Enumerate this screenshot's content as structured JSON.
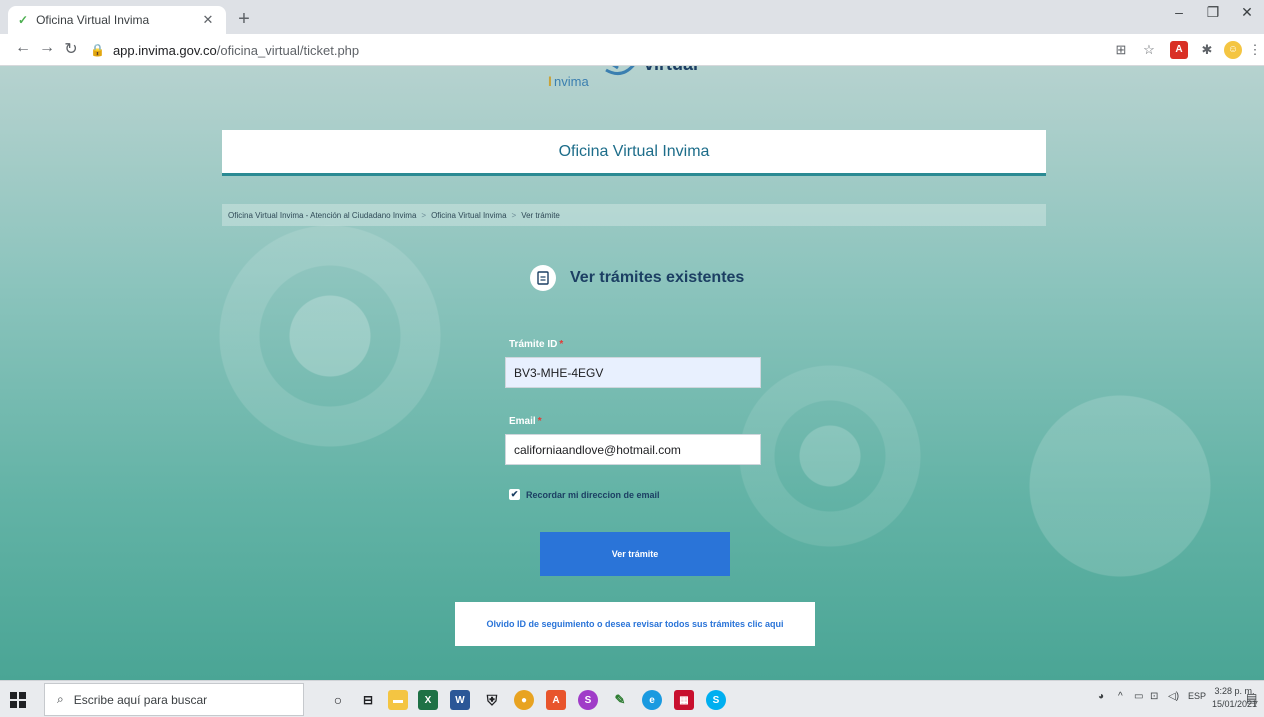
{
  "browser": {
    "tab_title": "Oficina Virtual Invima",
    "tab_favicon": "✓",
    "url_host": "app.invima.gov.co",
    "url_path": "/oficina_virtual/ticket.php"
  },
  "header": {
    "logo_text": "Invima",
    "logo_word": "virtual",
    "title": "Oficina Virtual Invima"
  },
  "breadcrumb": {
    "items": [
      "Oficina Virtual Invima - Atención al Ciudadano Invima",
      "Oficina Virtual Invima",
      "Ver trámite"
    ],
    "separator": ">"
  },
  "form": {
    "heading": "Ver trámites existentes",
    "tramite_label": "Trámite ID",
    "tramite_value": "BV3-MHE-4EGV",
    "email_label": "Email",
    "email_value": "californiaandlove@hotmail.com",
    "required_mark": "*",
    "remember_label": "Recordar mi direccion de email",
    "remember_checked": true,
    "submit_label": "Ver trámite",
    "forgot_text": "Olvido ID de seguimiento o desea revisar todos sus trámites clic aqui"
  },
  "taskbar": {
    "search_placeholder": "Escribe aquí para buscar",
    "language": "ESP",
    "time": "3:28 p. m.",
    "date": "15/01/2021",
    "notification_count": "7"
  },
  "colors": {
    "accent": "#2a74d8",
    "header_text": "#1d6d8a",
    "heading_text": "#1c3f63",
    "required": "#e53935"
  }
}
